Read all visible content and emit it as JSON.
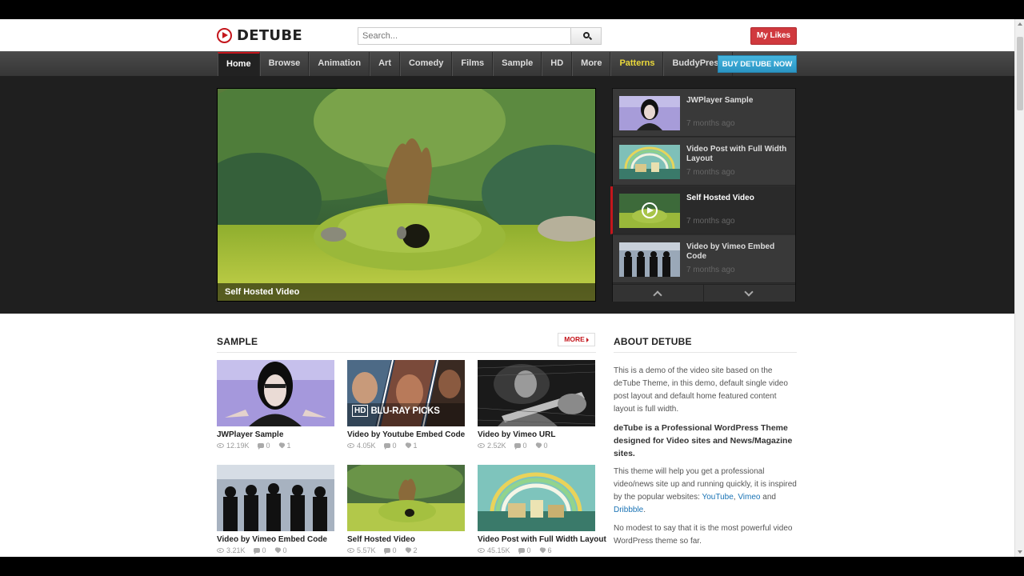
{
  "header": {
    "logo_text": "DETUBE",
    "search_placeholder": "Search...",
    "my_likes": "My Likes"
  },
  "nav": {
    "items": [
      "Home",
      "Browse",
      "Animation",
      "Art",
      "Comedy",
      "Films",
      "Sample",
      "HD",
      "More",
      "Patterns",
      "BuddyPress"
    ],
    "active": "Home",
    "buy_button": "BUY DETUBE NOW"
  },
  "featured": {
    "main_caption": "Self Hosted Video",
    "list": [
      {
        "title": "JWPlayer Sample",
        "date": "7 months ago"
      },
      {
        "title": "Video Post with Full Width Layout",
        "date": "7 months ago"
      },
      {
        "title": "Self Hosted Video",
        "date": "7 months ago"
      },
      {
        "title": "Video by Vimeo Embed Code",
        "date": "7 months ago"
      }
    ]
  },
  "sample": {
    "title": "SAMPLE",
    "more": "MORE",
    "videos": [
      {
        "title": "JWPlayer Sample",
        "views": "12.19K",
        "comments": "0",
        "likes": "1"
      },
      {
        "title": "Video by Youtube Embed Code",
        "views": "4.05K",
        "comments": "0",
        "likes": "1",
        "badge_hd": "HD",
        "badge_text": "BLU-RAY PICKS"
      },
      {
        "title": "Video by Vimeo URL",
        "views": "2.52K",
        "comments": "0",
        "likes": "0"
      },
      {
        "title": "Video by Vimeo Embed Code",
        "views": "3.21K",
        "comments": "0",
        "likes": "0"
      },
      {
        "title": "Self Hosted Video",
        "views": "5.57K",
        "comments": "0",
        "likes": "2"
      },
      {
        "title": "Video Post with Full Width Layout",
        "views": "45.15K",
        "comments": "0",
        "likes": "6"
      }
    ]
  },
  "about": {
    "title": "ABOUT DETUBE",
    "p1": "This is a demo of the video site based on the deTube Theme, in this demo, default single video post layout and default home featured content layout is full width.",
    "p2": "deTube is a Professional WordPress Theme designed for Video sites and News/Magazine sites.",
    "p3_prefix": "This theme will help you get a professional video/news site up and running quickly, it is inspired by the popular websites:",
    "link_youtube": "YouTube",
    "link_vimeo": "Vimeo",
    "and": "and",
    "link_dribbble": "Dribbble",
    "p4": "No modest to say that it is the most powerful video WordPress theme so far."
  },
  "colors": {
    "brand_red": "#c4161c",
    "nav_bg": "#3f3f3f",
    "featured_bg": "#1f1f1f",
    "buy_blue": "#2b95c4",
    "patterns_yellow": "#ebd93b",
    "link_blue": "#1a73b5"
  }
}
